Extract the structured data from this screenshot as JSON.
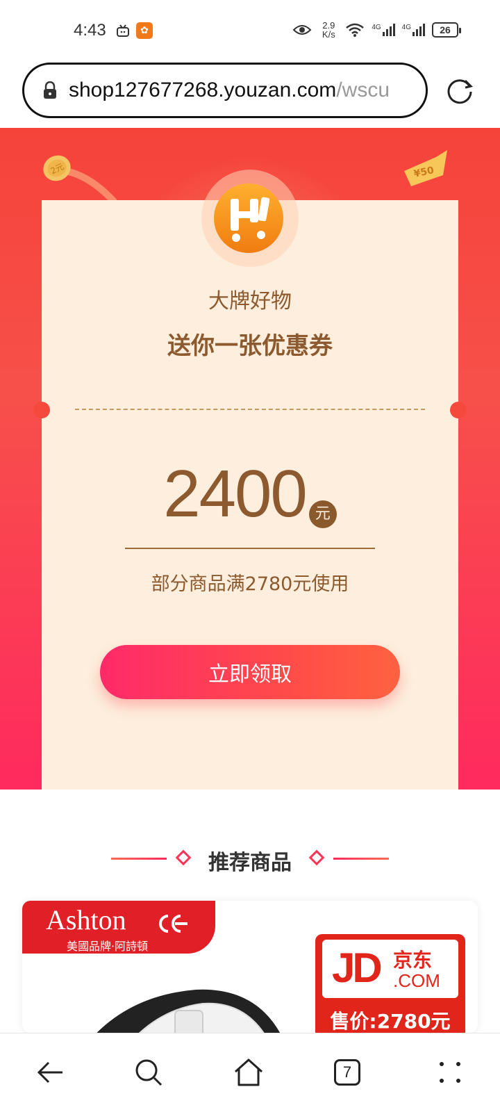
{
  "status_bar": {
    "time": "4:43",
    "net_speed_value": "2.9",
    "net_speed_unit": "K/s",
    "signal_1_label": "4G",
    "signal_2_label": "4G",
    "battery": "26"
  },
  "browser": {
    "url_host": "shop127677268.youzan.com",
    "url_path": "/wscu",
    "tab_count": "7"
  },
  "coupon": {
    "brand_title": "大牌好物",
    "headline": "送你一张优惠券",
    "amount": "2400",
    "unit": "元",
    "condition": "部分商品满2780元使用",
    "claim_label": "立即领取"
  },
  "decorations": {
    "coin_left_text": "2元",
    "coin_right_text": "¥50"
  },
  "recommended": {
    "title": "推荐商品"
  },
  "product": {
    "brand_name": "Ashton",
    "brand_subtitle": "美國品牌·阿詩頓",
    "jd_logo": "JD",
    "jd_cn": "京东",
    "jd_com": ".COM",
    "price_label": "售价:2780元"
  },
  "colors": {
    "banner_red": "#f5433a",
    "card_cream": "#fdeedd",
    "brown_text": "#8c5a2e",
    "button_pink": "#ff2a6a"
  }
}
